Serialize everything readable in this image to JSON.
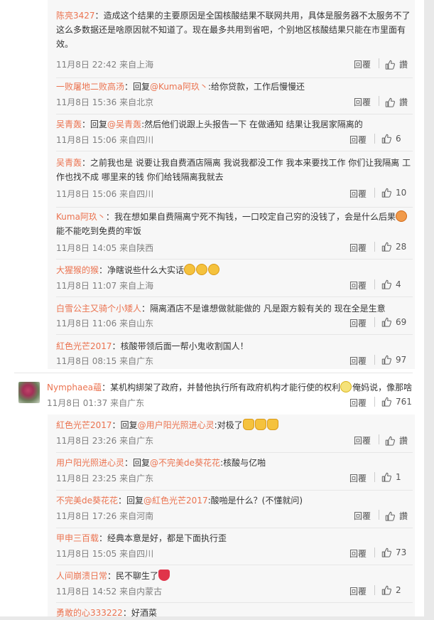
{
  "actions": {
    "reply_label": "回覆",
    "like_icon": "thumbs-up-icon"
  },
  "thread1": [
    {
      "user": "陈亮3427",
      "sep": "：",
      "text": "造成这个结果的主要原因是全国核酸结果不联网共用，具体是服务器不太服务不了这么多数据还是啥原因就不知道了。现在最多共用到省吧，个别地区核酸结果只能在市里面有效。",
      "meta": "11月8日 22:42 来自上海",
      "likes": "讚"
    },
    {
      "user": "一败屠地二败高汤",
      "sep": "：",
      "prefix": "回复",
      "mention": "@Kuma阿玖丶",
      "text": ":给你贷款，工作后慢慢还",
      "meta": "11月8日 15:36 来自北京",
      "likes": "讚"
    },
    {
      "user": "吴青轰",
      "sep": "：",
      "prefix": "回复",
      "mention": "@吴青轰",
      "text": ":然后他们说跟上头报告一下 在做通知 结果让我居家隔离的",
      "meta": "11月8日 15:06 来自四川",
      "likes": "6"
    },
    {
      "user": "吴青轰",
      "sep": "：",
      "text": "之前我也是 说要让我自费酒店隔离 我说我都没工作 我本来要找工作 你们让我隔离 工作也找不成 哪里来的钱 你们给钱隔离我就去",
      "meta": "11月8日 15:06 来自四川",
      "likes": "10"
    },
    {
      "user": "Kuma阿玖丶",
      "sep": "：",
      "text": "我在想如果自费隔离宁死不掏钱，一口咬定自己穷的没钱了，会是什么后果",
      "emoji": "rage",
      "text2": "能不能吃到免费的牢饭",
      "meta": "11月8日 14:05 来自陕西",
      "likes": "28"
    },
    {
      "user": "大猩猴的猴",
      "sep": "：",
      "text": "净瞎说些什么大实话",
      "emoji3": "smile",
      "meta": "11月8日 11:07 来自上海",
      "likes": "4"
    },
    {
      "user": "白雪公主又骑个小矮人",
      "sep": "：",
      "text": "隔离酒店不是谁想做就能做的 凡是跟方毅有关的 现在全是生意",
      "meta": "11月8日 11:06 来自山东",
      "likes": "69"
    },
    {
      "user": "紅色光芒2017",
      "sep": "：",
      "text": "核酸带领后面一帮小鬼收割国人！",
      "meta": "11月8日 08:15 来自广东",
      "likes": "97"
    }
  ],
  "main_comment": {
    "user": "Nymphaea蘊",
    "sep": "：",
    "text": "某机构綁架了政府，并替他执行所有政府机构才能行使的权利",
    "emoji": "glasses",
    "text2": "俺妈说，像那啥",
    "meta": "11月8日 01:37 来自广东",
    "likes": "761",
    "avatar_icon": "avatar-flower"
  },
  "thread2": [
    {
      "user": "紅色光芒2017",
      "sep": "：",
      "prefix": "回复",
      "mention": "@用户阳光照进心灵",
      "text": ":对极了",
      "emoji3": "thumb",
      "meta": "11月8日 23:26 来自广东",
      "likes": "讚"
    },
    {
      "user": "用户阳光照进心灵",
      "sep": "：",
      "prefix": "回复",
      "mention": "@不完美de葵花花",
      "text": ":核酸与亿啪",
      "meta": "11月8日 23:25 来自广东",
      "likes": "1"
    },
    {
      "user": "不完美de葵花花",
      "sep": "：",
      "prefix": "回复",
      "mention": "@紅色光芒2017",
      "text": ":酸啪是什么？(不懂就问)",
      "meta": "11月8日 17:26 来自河南",
      "likes": "讚"
    },
    {
      "user": "甲申三百载",
      "sep": "：",
      "text": "经典本意是好，都是下面执行歪",
      "meta": "11月8日 15:05 来自四川",
      "likes": "73"
    },
    {
      "user": "人间崩溃日常",
      "sep": "：",
      "text": "民不聊生了",
      "emoji": "heart",
      "meta": "11月8日 14:52 来自内蒙古",
      "likes": "2"
    },
    {
      "user": "勇敢的心333222",
      "sep": "：",
      "text": "好酒菜",
      "meta": "",
      "likes": ""
    }
  ]
}
